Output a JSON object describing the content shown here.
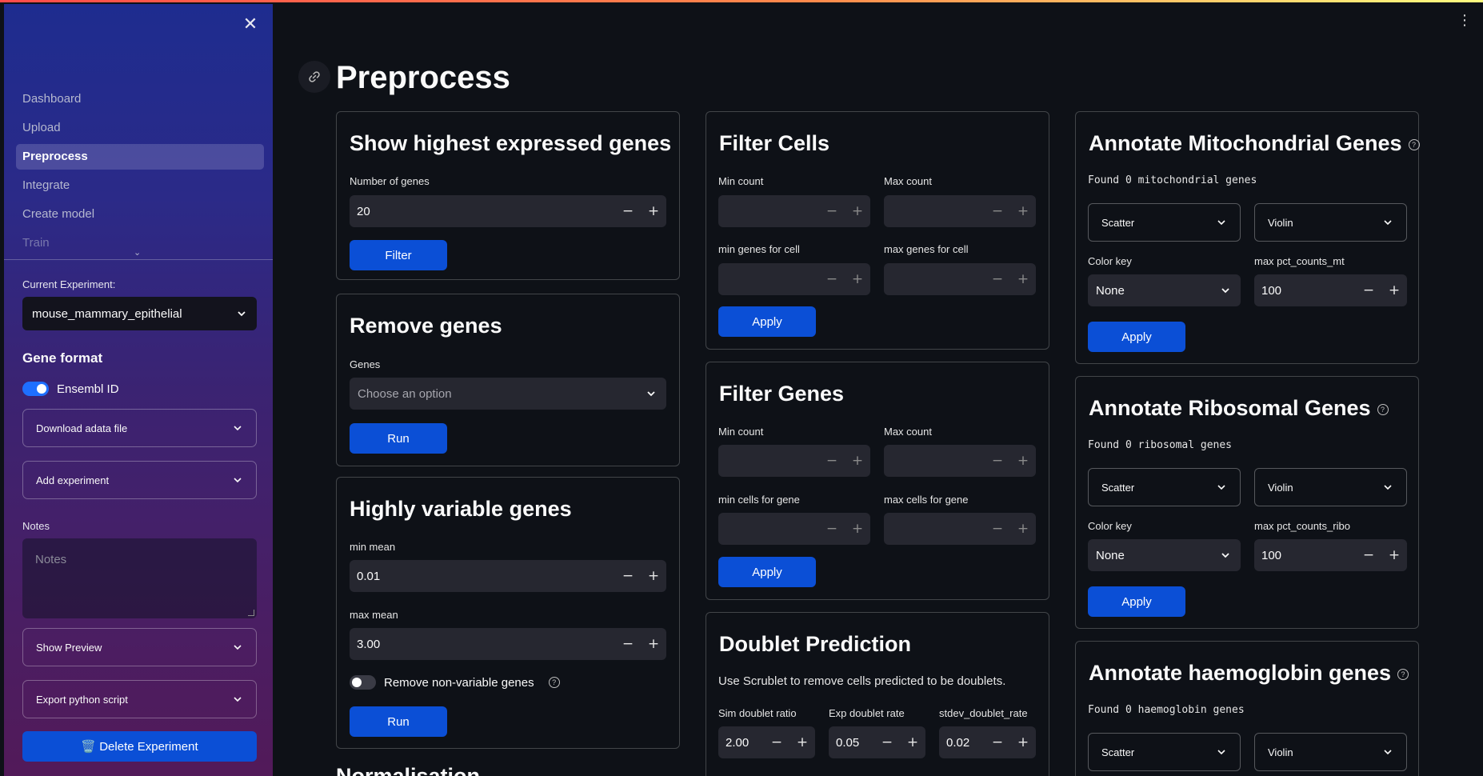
{
  "sidebar": {
    "nav": [
      "Dashboard",
      "Upload",
      "Preprocess",
      "Integrate",
      "Create model",
      "Train"
    ],
    "current_experiment_label": "Current Experiment:",
    "current_experiment_value": "mouse_mammary_epithelial",
    "gene_format_title": "Gene format",
    "ensembl_toggle_label": "Ensembl ID",
    "ensembl_toggle_on": true,
    "download_label": "Download adata file",
    "add_experiment_label": "Add experiment",
    "notes_label": "Notes",
    "notes_placeholder": "Notes",
    "show_preview_label": "Show Preview",
    "export_label": "Export python script",
    "delete_label": "🗑️ Delete Experiment"
  },
  "page": {
    "title": "Preprocess"
  },
  "highest": {
    "title": "Show highest expressed genes",
    "num_genes_label": "Number of genes",
    "num_genes_value": "20",
    "button": "Filter"
  },
  "remove_genes": {
    "title": "Remove genes",
    "genes_label": "Genes",
    "placeholder": "Choose an option",
    "button": "Run"
  },
  "hvg": {
    "title": "Highly variable genes",
    "min_mean_label": "min mean",
    "min_mean_value": "0.01",
    "max_mean_label": "max mean",
    "max_mean_value": "3.00",
    "toggle_label": "Remove non-variable genes",
    "button": "Run"
  },
  "normalisation_partial": "Normalisation",
  "filter_cells": {
    "title": "Filter Cells",
    "min_count": "Min count",
    "max_count": "Max count",
    "min_genes": "min genes for cell",
    "max_genes": "max genes for cell",
    "button": "Apply"
  },
  "filter_genes": {
    "title": "Filter Genes",
    "min_count": "Min count",
    "max_count": "Max count",
    "min_cells": "min cells for gene",
    "max_cells": "max cells for gene",
    "button": "Apply"
  },
  "doublet": {
    "title": "Doublet Prediction",
    "desc": "Use Scrublet to remove cells predicted to be doublets.",
    "sim_label": "Sim doublet ratio",
    "sim_value": "2.00",
    "exp_label": "Exp doublet rate",
    "exp_value": "0.05",
    "stdev_label": "stdev_doublet_rate",
    "stdev_value": "0.02"
  },
  "mito": {
    "title": "Annotate Mitochondrial Genes",
    "found": "Found 0 mitochondrial genes",
    "plot1": "Scatter",
    "plot2": "Violin",
    "color_key_label": "Color key",
    "color_key_value": "None",
    "max_label": "max pct_counts_mt",
    "max_value": "100",
    "button": "Apply"
  },
  "ribo": {
    "title": "Annotate Ribosomal Genes",
    "found": "Found 0 ribosomal genes",
    "plot1": "Scatter",
    "plot2": "Violin",
    "color_key_label": "Color key",
    "color_key_value": "None",
    "max_label": "max pct_counts_ribo",
    "max_value": "100",
    "button": "Apply"
  },
  "haemo": {
    "title": "Annotate haemoglobin genes",
    "found": "Found 0 haemoglobin genes",
    "plot1": "Scatter",
    "plot2": "Violin"
  },
  "colors": {
    "primary_button": "#0b4fd6",
    "background": "#0e1117",
    "input": "#262730",
    "toggle_on": "#1e6fff"
  }
}
